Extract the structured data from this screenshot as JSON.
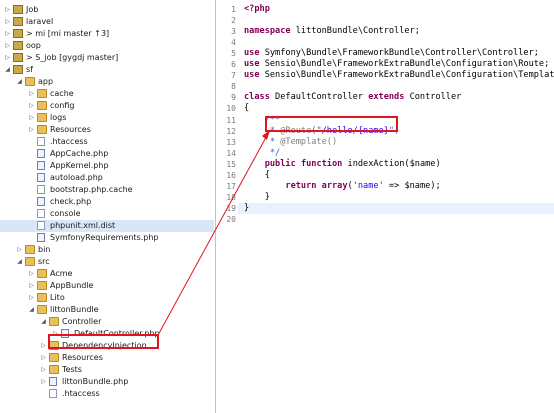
{
  "tree": {
    "items": [
      {
        "label": "Job",
        "type": "project",
        "toggle": "closed"
      },
      {
        "label": "laravel",
        "type": "project",
        "toggle": "closed"
      },
      {
        "label": "> mi  [mi master ↑3]",
        "type": "project",
        "toggle": "closed"
      },
      {
        "label": "oop",
        "type": "project",
        "toggle": "closed"
      },
      {
        "label": "> S_job  [gygdj master]",
        "type": "project",
        "toggle": "closed"
      },
      {
        "label": "sf",
        "type": "project",
        "toggle": "open"
      },
      {
        "label": "app",
        "type": "folder",
        "toggle": "open"
      },
      {
        "label": "cache",
        "type": "folder",
        "toggle": "closed"
      },
      {
        "label": "config",
        "type": "folder",
        "toggle": "closed"
      },
      {
        "label": "logs",
        "type": "folder",
        "toggle": "closed"
      },
      {
        "label": "Resources",
        "type": "folder",
        "toggle": "closed"
      },
      {
        "label": ".htaccess",
        "type": "file",
        "toggle": ""
      },
      {
        "label": "AppCache.php",
        "type": "php",
        "toggle": ""
      },
      {
        "label": "AppKernel.php",
        "type": "php",
        "toggle": ""
      },
      {
        "label": "autoload.php",
        "type": "php",
        "toggle": ""
      },
      {
        "label": "bootstrap.php.cache",
        "type": "file",
        "toggle": ""
      },
      {
        "label": "check.php",
        "type": "php",
        "toggle": ""
      },
      {
        "label": "console",
        "type": "file",
        "toggle": ""
      },
      {
        "label": "phpunit.xml.dist",
        "type": "file",
        "toggle": ""
      },
      {
        "label": "SymfonyRequirements.php",
        "type": "php",
        "toggle": ""
      },
      {
        "label": "bin",
        "type": "folder",
        "toggle": "closed"
      },
      {
        "label": "src",
        "type": "folder",
        "toggle": "open"
      },
      {
        "label": "Acme",
        "type": "folder",
        "toggle": "closed"
      },
      {
        "label": "AppBundle",
        "type": "folder",
        "toggle": "closed"
      },
      {
        "label": "Lito",
        "type": "folder",
        "toggle": "closed"
      },
      {
        "label": "littonBundle",
        "type": "folder",
        "toggle": "open"
      },
      {
        "label": "Controller",
        "type": "folder",
        "toggle": "open"
      },
      {
        "label": "DefaultController.php",
        "type": "php",
        "toggle": "closed"
      },
      {
        "label": "DependencyInjection",
        "type": "folder",
        "toggle": "closed"
      },
      {
        "label": "Resources",
        "type": "folder",
        "toggle": "closed"
      },
      {
        "label": "Tests",
        "type": "folder",
        "toggle": "closed"
      },
      {
        "label": "littonBundle.php",
        "type": "php",
        "toggle": "closed"
      },
      {
        "label": ".htaccess",
        "type": "file",
        "toggle": ""
      }
    ]
  },
  "editor": {
    "lines": [
      {
        "n": "1",
        "text": "<?php"
      },
      {
        "n": "2",
        "text": ""
      },
      {
        "n": "3",
        "text": "namespace littonBundle\\Controller;"
      },
      {
        "n": "4",
        "text": ""
      },
      {
        "n": "5",
        "text": "use Symfony\\Bundle\\FrameworkBundle\\Controller\\Controller;"
      },
      {
        "n": "6",
        "text": "use Sensio\\Bundle\\FrameworkExtraBundle\\Configuration\\Route;"
      },
      {
        "n": "7",
        "text": "use Sensio\\Bundle\\FrameworkExtraBundle\\Configuration\\Template;"
      },
      {
        "n": "8",
        "text": ""
      },
      {
        "n": "9",
        "text": "class DefaultController extends Controller"
      },
      {
        "n": "10",
        "text": "{"
      },
      {
        "n": "11",
        "text": "    /**"
      },
      {
        "n": "12",
        "text": "     * @Route(\"/hello/{name}\")"
      },
      {
        "n": "13",
        "text": "     * @Template()"
      },
      {
        "n": "14",
        "text": "     */"
      },
      {
        "n": "15",
        "text": "    public function indexAction($name)"
      },
      {
        "n": "16",
        "text": "    {"
      },
      {
        "n": "17",
        "text": "        return array('name' => $name);"
      },
      {
        "n": "18",
        "text": "    }"
      },
      {
        "n": "19",
        "text": "}"
      },
      {
        "n": "20",
        "text": ""
      }
    ],
    "tokens": {
      "kw_php": "<?php",
      "kw_namespace": "namespace",
      "ns_name": " littonBundle\\Controller;",
      "kw_use": "use",
      "use1": " Symfony\\Bundle\\FrameworkBundle\\Controller\\Controller;",
      "use2": " Sensio\\Bundle\\FrameworkExtraBundle\\Configuration\\Route;",
      "use3": " Sensio\\Bundle\\FrameworkExtraBundle\\Configuration\\Template;",
      "kw_class": "class",
      "class_name": " DefaultController ",
      "kw_extends": "extends",
      "parent": " Controller",
      "brace_open": "{",
      "doc_open": "    /**",
      "doc_star": "     * ",
      "ann_route": "@Route",
      "route_open": "(\"",
      "route_val": "/hello/{name}",
      "route_close": "\")",
      "ann_template": "@Template()",
      "doc_close": "     */",
      "kw_public": "public",
      "kw_function": "function",
      "method_sig": " indexAction($name)",
      "inner_open": "    {",
      "kw_return": "return",
      "kw_array": "array",
      "arr_open": "(",
      "arr_key": "'name'",
      "arr_rest": " => $name);",
      "inner_close": "    }",
      "brace_close": "}"
    }
  },
  "colors": {
    "keyword": "#7f0055",
    "doc_comment": "#3f5fbf",
    "annotation": "#808080",
    "string": "#2a00ff",
    "highlight_box": "#e0151d",
    "selection": "#d8e6f7"
  }
}
